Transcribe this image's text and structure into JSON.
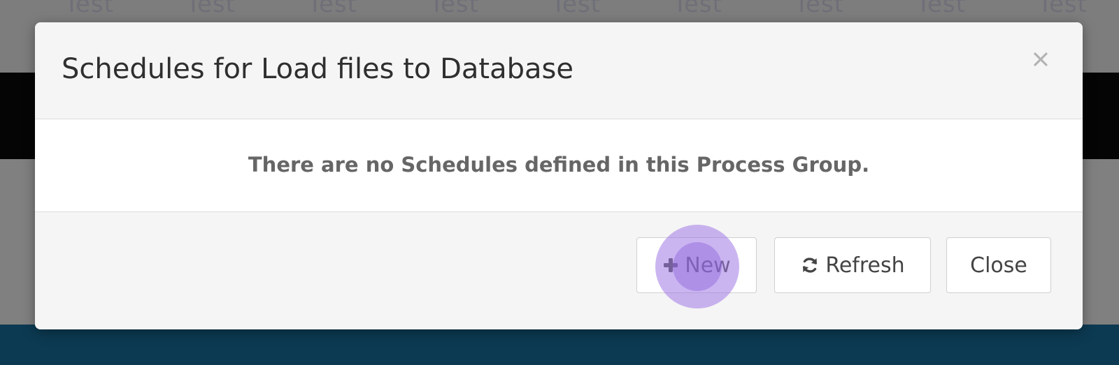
{
  "background": {
    "column_labels": [
      "Test",
      "Test",
      "Test",
      "Test",
      "Test",
      "Test",
      "Test",
      "Test",
      "Test"
    ]
  },
  "modal": {
    "title": "Schedules for Load files to Database",
    "close_icon": "close-icon",
    "empty_message": "There are no Schedules defined in this Process Group.",
    "buttons": {
      "new_label": "New",
      "new_icon": "plus-icon",
      "refresh_label": "Refresh",
      "refresh_icon": "refresh-icon",
      "close_label": "Close"
    }
  },
  "colors": {
    "footer_band": "#0c3a52",
    "modal_bg": "#f5f5f5",
    "click_indicator": "#a078e6"
  }
}
